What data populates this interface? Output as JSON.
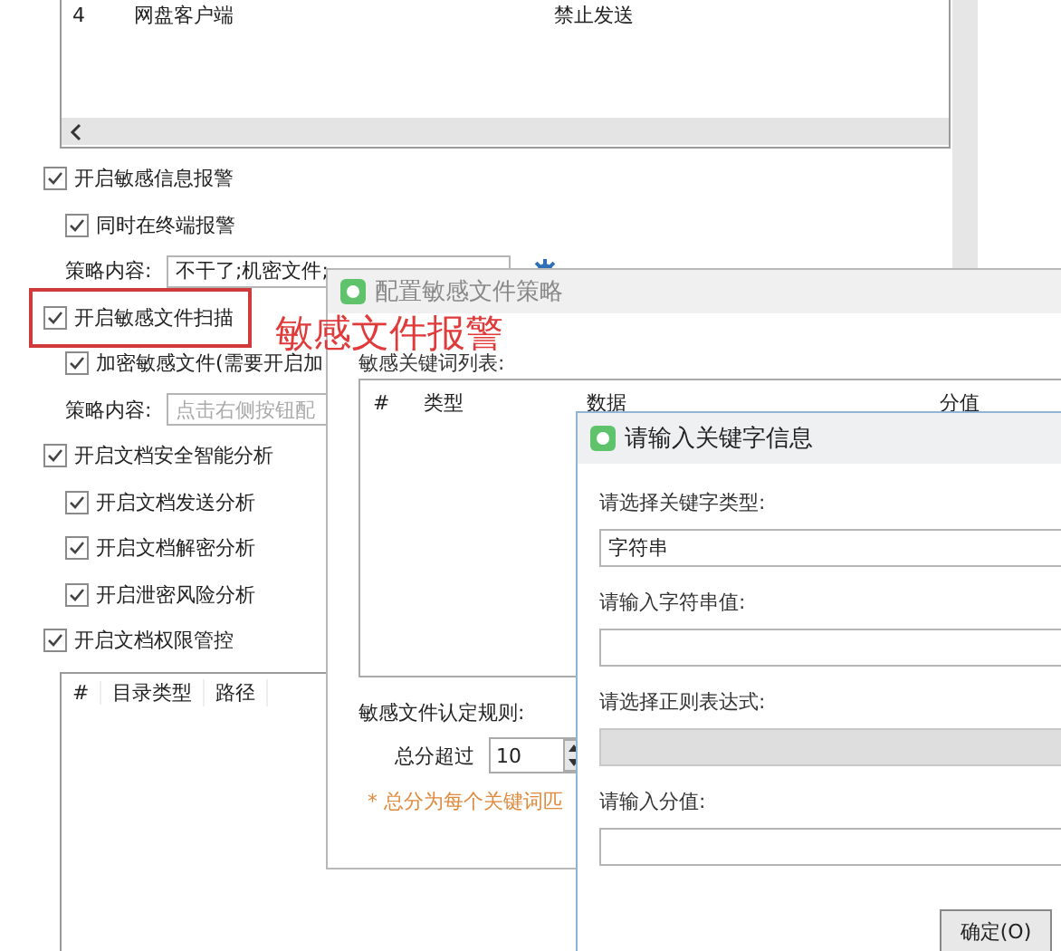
{
  "rules_table": {
    "rows": [
      {
        "index": "4",
        "name": "网盘客户端",
        "action": "禁止发送"
      }
    ]
  },
  "options": [
    {
      "kind": "checkbox",
      "label": "开启敏感信息报警",
      "checked": true,
      "children": [
        {
          "kind": "checkbox",
          "label": "同时在终端报警",
          "checked": true
        },
        {
          "kind": "field",
          "label": "策略内容:",
          "value": "不干了;机密文件;",
          "settings_button": true
        }
      ]
    },
    {
      "kind": "checkbox",
      "label": "开启敏感文件扫描",
      "checked": true,
      "annotated": true,
      "children": [
        {
          "kind": "checkbox",
          "label": "加密敏感文件(需要开启加",
          "checked": true
        },
        {
          "kind": "field",
          "label": "策略内容:",
          "placeholder": "点击右侧按钮配",
          "settings_button": false
        }
      ]
    },
    {
      "kind": "checkbox",
      "label": "开启文档安全智能分析",
      "checked": true,
      "children": [
        {
          "kind": "checkbox",
          "label": "开启文档发送分析",
          "checked": true
        },
        {
          "kind": "checkbox",
          "label": "开启文档解密分析",
          "checked": true
        },
        {
          "kind": "checkbox",
          "label": "开启泄密风险分析",
          "checked": true
        }
      ]
    },
    {
      "kind": "checkbox",
      "label": "开启文档权限管控",
      "checked": true
    }
  ],
  "directory_table": {
    "columns": [
      "#",
      "目录类型",
      "路径"
    ]
  },
  "annotation": {
    "text": "敏感文件报警"
  },
  "policy_dialog": {
    "title": "配置敏感文件策略",
    "list_label": "敏感关键词列表:",
    "columns": [
      "#",
      "类型",
      "数据",
      "分值"
    ],
    "rule_label": "敏感文件认定规则:",
    "threshold_label": "总分超过",
    "threshold_value": "10",
    "note": "* 总分为每个关键词匹"
  },
  "keyword_dialog": {
    "title": "请输入关键字信息",
    "fields": [
      {
        "label": "请选择关键字类型:",
        "value": "字符串",
        "disabled": false
      },
      {
        "label": "请输入字符串值:",
        "disabled": false
      },
      {
        "label": "请选择正则表达式:",
        "disabled": true
      },
      {
        "label": "请输入分值:",
        "disabled": false
      }
    ],
    "ok_button": "确定(O)"
  }
}
